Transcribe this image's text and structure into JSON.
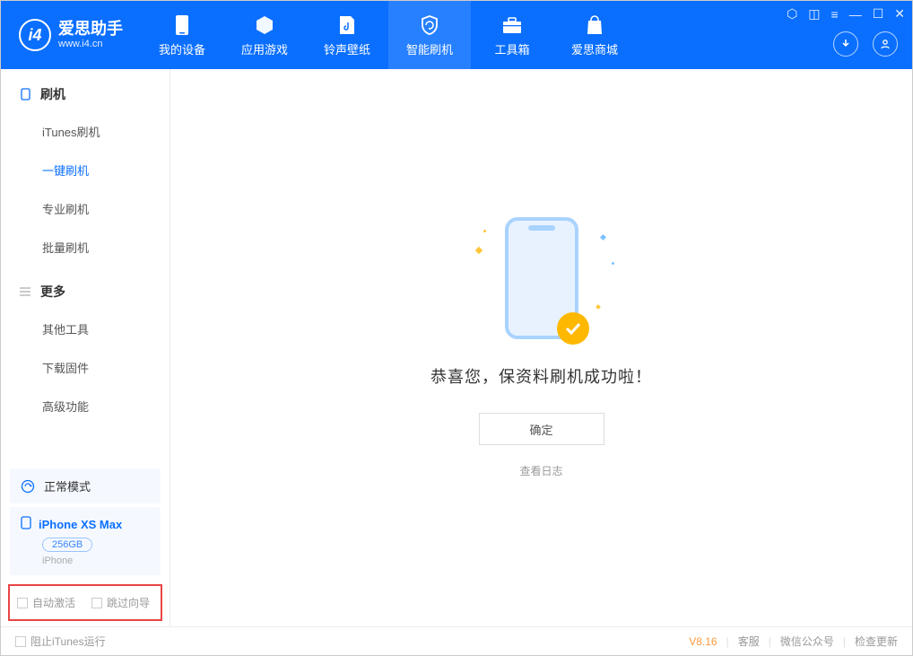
{
  "app": {
    "title": "爱思助手",
    "subtitle": "www.i4.cn"
  },
  "nav": {
    "items": [
      {
        "label": "我的设备"
      },
      {
        "label": "应用游戏"
      },
      {
        "label": "铃声壁纸"
      },
      {
        "label": "智能刷机"
      },
      {
        "label": "工具箱"
      },
      {
        "label": "爱思商城"
      }
    ]
  },
  "sidebar": {
    "group1": {
      "title": "刷机",
      "items": [
        "iTunes刷机",
        "一键刷机",
        "专业刷机",
        "批量刷机"
      ]
    },
    "group2": {
      "title": "更多",
      "items": [
        "其他工具",
        "下载固件",
        "高级功能"
      ]
    },
    "status": "正常模式",
    "device": {
      "name": "iPhone XS Max",
      "capacity": "256GB",
      "type": "iPhone"
    },
    "checks": {
      "auto_activate": "自动激活",
      "skip_guide": "跳过向导"
    }
  },
  "content": {
    "success": "恭喜您，保资料刷机成功啦！",
    "ok_btn": "确定",
    "view_log": "查看日志"
  },
  "footer": {
    "block_itunes": "阻止iTunes运行",
    "version": "V8.16",
    "links": [
      "客服",
      "微信公众号",
      "检查更新"
    ]
  }
}
